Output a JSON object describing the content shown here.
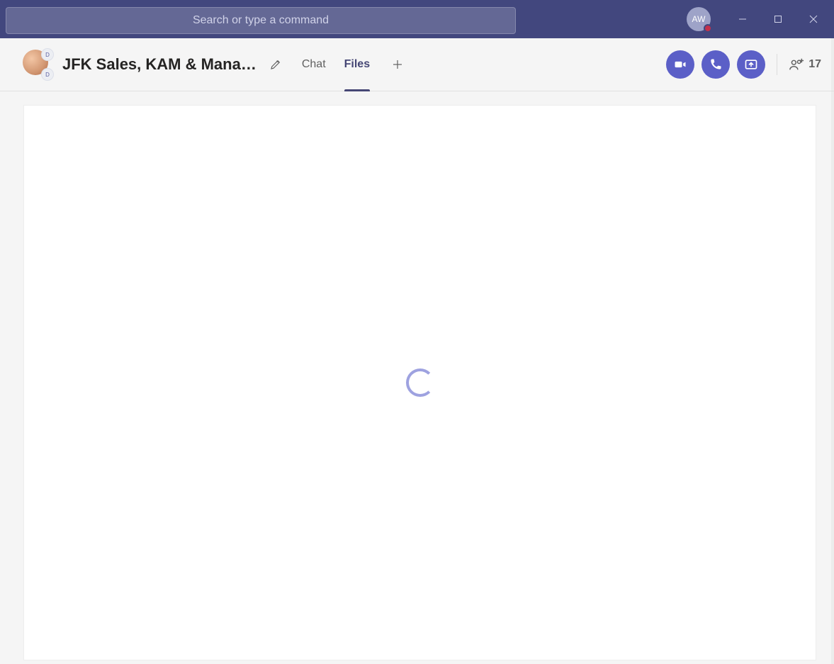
{
  "titlebar": {
    "search_placeholder": "Search or type a command",
    "me_initials": "AW"
  },
  "chat": {
    "title": "JFK Sales, KAM & Mana…",
    "group_badge_top": "D",
    "group_badge_bottom": "D",
    "participant_count": "17"
  },
  "tabs": {
    "chat": "Chat",
    "files": "Files",
    "active": "files"
  },
  "icons": {
    "pencil": "pencil-icon",
    "plus": "plus-icon",
    "video": "video-icon",
    "phone": "phone-icon",
    "share": "share-screen-icon",
    "people": "people-icon",
    "minimize": "minimize-icon",
    "maximize": "maximize-icon",
    "close": "close-icon"
  }
}
